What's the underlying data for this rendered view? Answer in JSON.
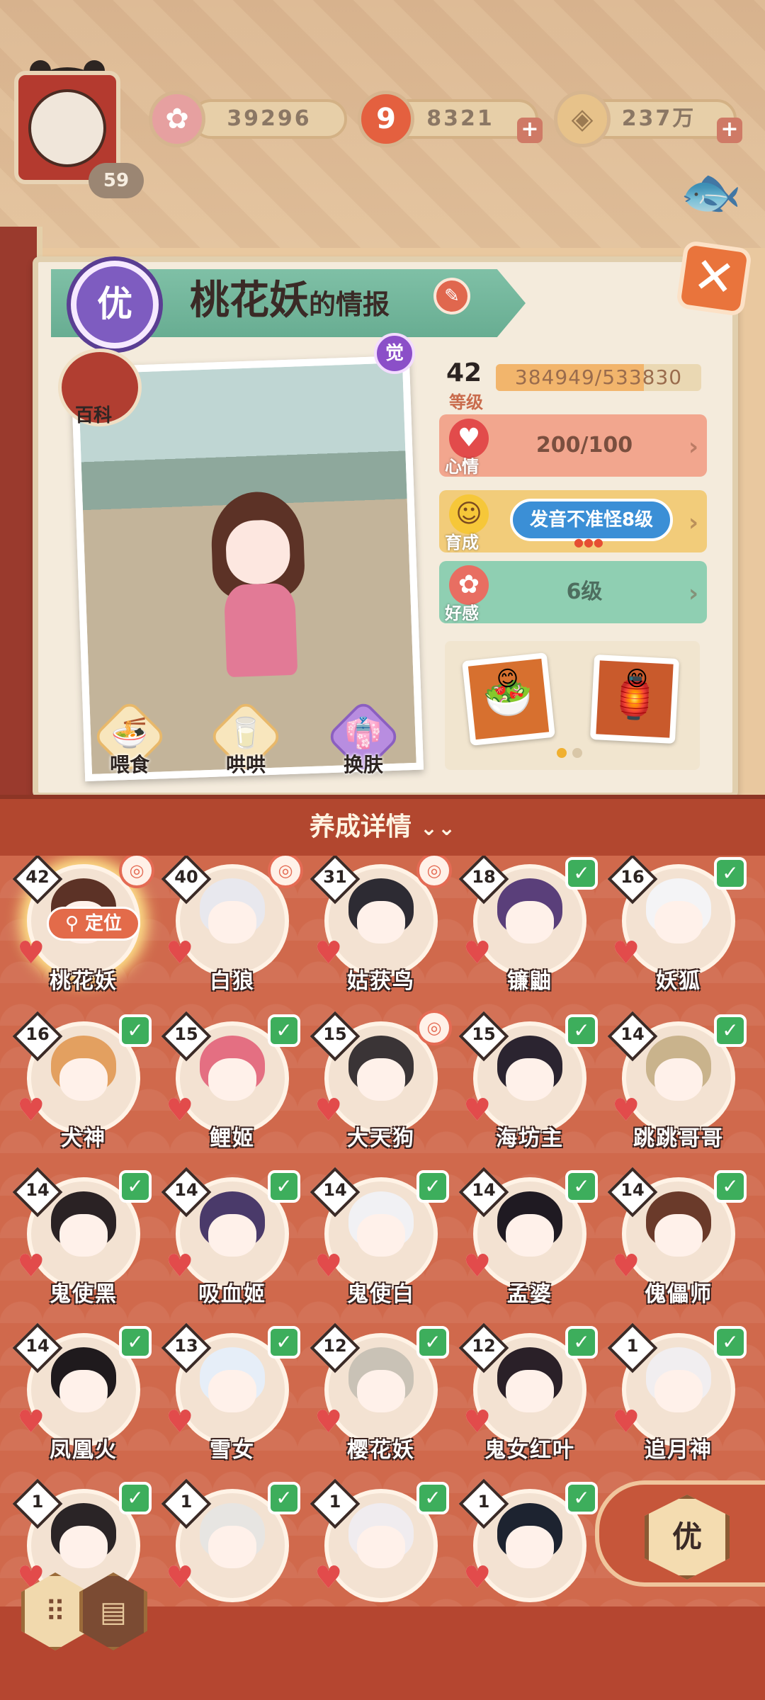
{
  "hud": {
    "player_level": "59",
    "resources": [
      {
        "icon": "sakura-flower-icon",
        "value": "39296"
      },
      {
        "icon": "magatama-icon",
        "value": "8321"
      },
      {
        "icon": "coin-icon",
        "value": "237万"
      }
    ]
  },
  "info": {
    "rarity": "优",
    "name": "桃花妖",
    "title_suffix": "的情报",
    "awakened_badge": "觉",
    "wiki_label": "百科",
    "level": "42",
    "level_label": "等级",
    "exp_text": "384949/533830",
    "exp_fraction": 0.721,
    "stats": [
      {
        "label": "心情",
        "value": "200/100",
        "icon": "heart-face-icon",
        "color": "#f2a68e"
      },
      {
        "label": "育成",
        "value": "发音不准怪8级",
        "icon": "smile-face-icon",
        "color": "#f2cc7a"
      },
      {
        "label": "好感",
        "value": "6级",
        "icon": "flower-icon",
        "color": "#8fcfb2"
      }
    ],
    "actions": [
      {
        "label": "喂食",
        "icon": "bowl-icon"
      },
      {
        "label": "哄哄",
        "icon": "milk-icon"
      },
      {
        "label": "换肤",
        "icon": "kimono-icon"
      }
    ]
  },
  "detail_label": "养成详情",
  "locate_label": "定位",
  "shikigami": [
    {
      "name": "桃花妖",
      "level": "42",
      "mark": "seal",
      "hair": "#5c3226"
    },
    {
      "name": "白狼",
      "level": "40",
      "mark": "seal",
      "hair": "#e8e8ee"
    },
    {
      "name": "姑获鸟",
      "level": "31",
      "mark": "seal",
      "hair": "#2d2b33"
    },
    {
      "name": "镰鼬",
      "level": "18",
      "mark": "check",
      "hair": "#5a3f7a"
    },
    {
      "name": "妖狐",
      "level": "16",
      "mark": "check",
      "hair": "#f4f4f6"
    },
    {
      "name": "犬神",
      "level": "16",
      "mark": "check",
      "hair": "#e3a060"
    },
    {
      "name": "鲤姬",
      "level": "15",
      "mark": "check",
      "hair": "#e46f82"
    },
    {
      "name": "大天狗",
      "level": "15",
      "mark": "seal",
      "hair": "#3a3436"
    },
    {
      "name": "海坊主",
      "level": "15",
      "mark": "check",
      "hair": "#2b2430"
    },
    {
      "name": "跳跳哥哥",
      "level": "14",
      "mark": "check",
      "hair": "#c9b38c"
    },
    {
      "name": "鬼使黑",
      "level": "14",
      "mark": "check",
      "hair": "#2a2224"
    },
    {
      "name": "吸血姬",
      "level": "14",
      "mark": "check",
      "hair": "#4a3a6a"
    },
    {
      "name": "鬼使白",
      "level": "14",
      "mark": "check",
      "hair": "#f1f1f4"
    },
    {
      "name": "孟婆",
      "level": "14",
      "mark": "check",
      "hair": "#1f1a22"
    },
    {
      "name": "傀儡师",
      "level": "14",
      "mark": "check",
      "hair": "#6a3a2a"
    },
    {
      "name": "凤凰火",
      "level": "14",
      "mark": "check",
      "hair": "#1f1a1d"
    },
    {
      "name": "雪女",
      "level": "13",
      "mark": "check",
      "hair": "#e6eef8"
    },
    {
      "name": "樱花妖",
      "level": "12",
      "mark": "check",
      "hair": "#c9c2b6"
    },
    {
      "name": "鬼女红叶",
      "level": "12",
      "mark": "check",
      "hair": "#2a2028"
    },
    {
      "name": "追月神",
      "level": "1",
      "mark": "check",
      "hair": "#f1eef0"
    },
    {
      "name": "",
      "level": "1",
      "mark": "check",
      "hair": "#2a2426"
    },
    {
      "name": "",
      "level": "1",
      "mark": "check",
      "hair": "#e7e5e2"
    },
    {
      "name": "",
      "level": "1",
      "mark": "check",
      "hair": "#f0ecef"
    },
    {
      "name": "",
      "level": "1",
      "mark": "check",
      "hair": "#1d2330"
    }
  ],
  "rarity_filter": "优",
  "colors": {
    "accent": "#e36b4a",
    "grid_bg": "#d0694c",
    "check": "#3dae5c"
  }
}
